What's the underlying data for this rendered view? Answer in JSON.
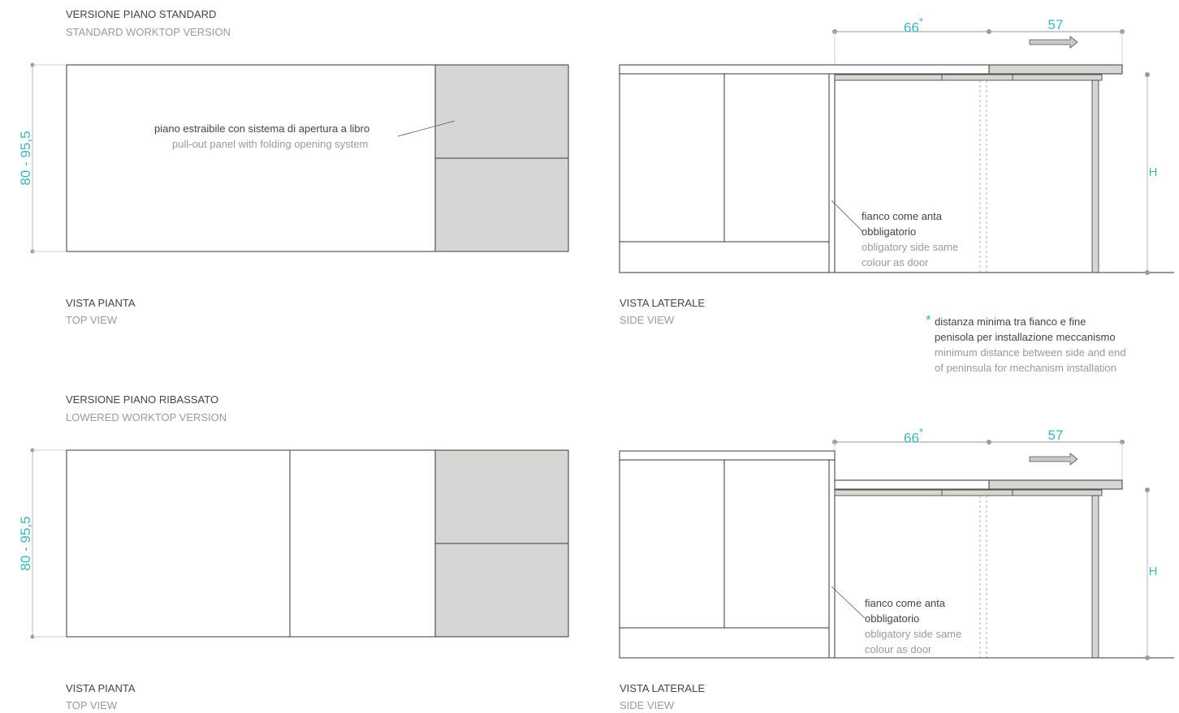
{
  "standard": {
    "title_it": "VERSIONE PIANO STANDARD",
    "title_en": "STANDARD WORKTOP VERSION",
    "height_dim": "80 - 95,5",
    "panel_label_it": "piano estraibile con sistema di apertura a libro",
    "panel_label_en": "pull-out panel with folding opening system",
    "top_view_it": "VISTA PIANTA",
    "top_view_en": "TOP VIEW",
    "side_view_it": "VISTA LATERALE",
    "side_view_en": "SIDE VIEW",
    "dim_left": "66",
    "dim_left_mark": "*",
    "dim_right": "57",
    "dim_h": "H",
    "side_note_it_1": "fianco come anta",
    "side_note_it_2": "obbligatorio",
    "side_note_en_1": "obligatory side same",
    "side_note_en_2": "colour as door"
  },
  "footnote": {
    "mark": "*",
    "it_1": "distanza minima tra fianco e fine",
    "it_2": "penisola per installazione meccanismo",
    "en_1": "minimum distance between side and end",
    "en_2": "of peninsula for mechanism installation"
  },
  "lowered": {
    "title_it": "VERSIONE PIANO RIBASSATO",
    "title_en": "LOWERED WORKTOP VERSION",
    "height_dim": "80 - 95,5",
    "top_view_it": "VISTA PIANTA",
    "top_view_en": "TOP VIEW",
    "side_view_it": "VISTA LATERALE",
    "side_view_en": "SIDE VIEW",
    "dim_left": "66",
    "dim_left_mark": "*",
    "dim_right": "57",
    "dim_h": "H",
    "side_note_it_1": "fianco come anta",
    "side_note_it_2": "obbligatorio",
    "side_note_en_1": "obligatory side same",
    "side_note_en_2": "colour as door"
  },
  "colors": {
    "accent": "#3fb5b5",
    "panel_fill": "#d6d7d2",
    "line": "#3a3a3a",
    "dim_line": "#9a9a9a"
  }
}
